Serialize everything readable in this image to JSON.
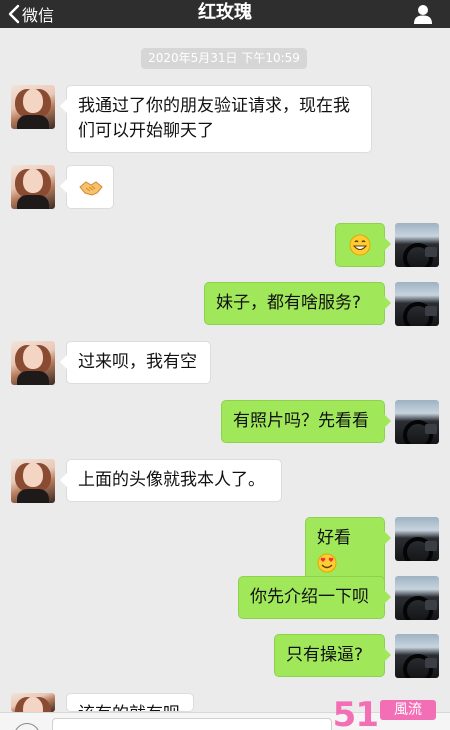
{
  "nav": {
    "back_label": "微信",
    "title": "红玫瑰",
    "back_icon": "chevron-left-icon",
    "profile_icon": "person-icon"
  },
  "timestamp": "2020年5月31日 下午10:59",
  "messages": [
    {
      "side": "left",
      "text": "我通过了你的朋友验证请求，现在我们可以开始聊天了"
    },
    {
      "side": "left",
      "emoji": "handshake-emoji"
    },
    {
      "side": "right",
      "emoji": "grinning-emoji"
    },
    {
      "side": "right",
      "text": "妹子，都有啥服务?"
    },
    {
      "side": "left",
      "text": "过来呗，我有空"
    },
    {
      "side": "right",
      "text": "有照片吗？先看看"
    },
    {
      "side": "left",
      "text": "上面的头像就我本人了。"
    },
    {
      "side": "right",
      "text": "好看",
      "emoji": "heart-eyes-emoji"
    },
    {
      "side": "right",
      "text": "你先介绍一下呗"
    },
    {
      "side": "right",
      "text": "只有操逼?"
    },
    {
      "side": "left",
      "text": "该有的就有呗"
    }
  ],
  "watermark": {
    "number": "51",
    "tag": "風流"
  },
  "colors": {
    "navbar": "#2e2e2e",
    "background": "#ebebeb",
    "sent_bubble": "#a0e75a",
    "received_bubble": "#ffffff",
    "watermark": "#f36fb5"
  }
}
